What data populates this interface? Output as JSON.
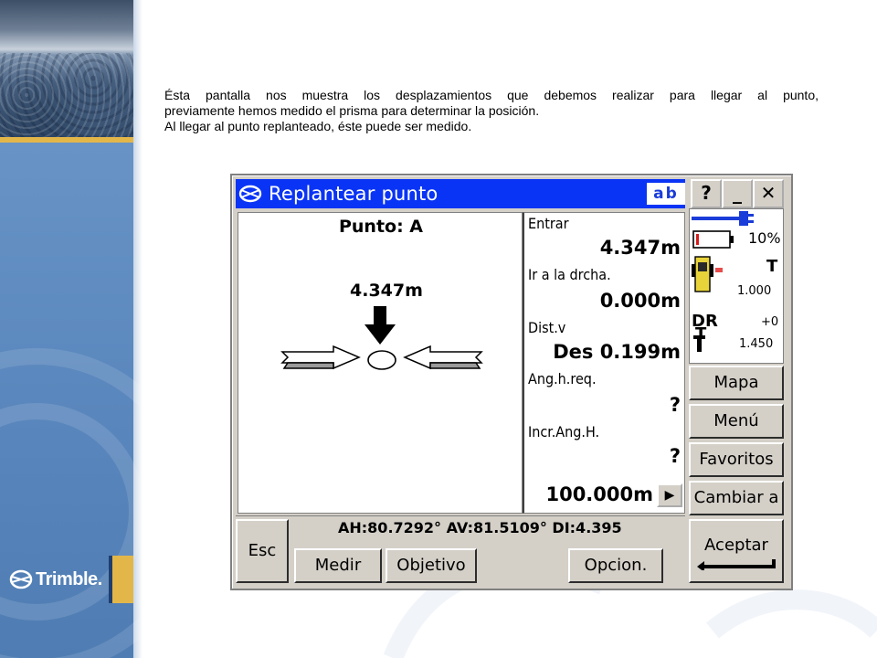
{
  "slide": {
    "description": [
      "Ésta pantalla nos muestra los desplazamientos que debemos realizar para llegar al punto,",
      "previamente hemos medido el prisma para determinar la posición.",
      "Al llegar al punto replanteado, éste puede ser medido."
    ],
    "logo_text": "Trimble."
  },
  "window": {
    "title": "Replantear punto",
    "input_mode": "ab",
    "help_label": "?",
    "minimize_label": "_",
    "close_label": "✕"
  },
  "graphic": {
    "point_label": "Punto: A",
    "arrow_distance": "4.347m"
  },
  "readings": {
    "entrar_label": "Entrar",
    "entrar_value": "4.347m",
    "derecha_label": "Ir a la drcha.",
    "derecha_value": "0.000m",
    "distv_label": "Dist.v",
    "distv_value": "Des 0.199m",
    "anghreq_label": "Ang.h.req.",
    "anghreq_value": "?",
    "incrangh_label": "Incr.Ang.H.",
    "incrangh_value": "?",
    "distance_field": "100.000m",
    "distance_arrow": "▶"
  },
  "status": {
    "battery_percent": "10%",
    "battery_level": 0.1,
    "target_letter": "T",
    "target_height": "1.000",
    "dr_label": "DR",
    "instrument_letter": "T",
    "prism_offset": "+0",
    "instrument_height": "1.450"
  },
  "side_buttons": {
    "map": "Mapa",
    "menu": "Menú",
    "favorites": "Favoritos",
    "switch_to": "Cambiar a"
  },
  "bottom": {
    "measurement": "AH:80.7292°  AV:81.5109°  DI:4.395",
    "esc": "Esc",
    "measure": "Medir",
    "target": "Objetivo",
    "options": "Opcion.",
    "accept": "Aceptar"
  },
  "colors": {
    "title_bar": "#0a34f5",
    "window_face": "#d4d0c8",
    "slide_band": "#5a87bd",
    "accent_gold": "#e3b64a"
  }
}
